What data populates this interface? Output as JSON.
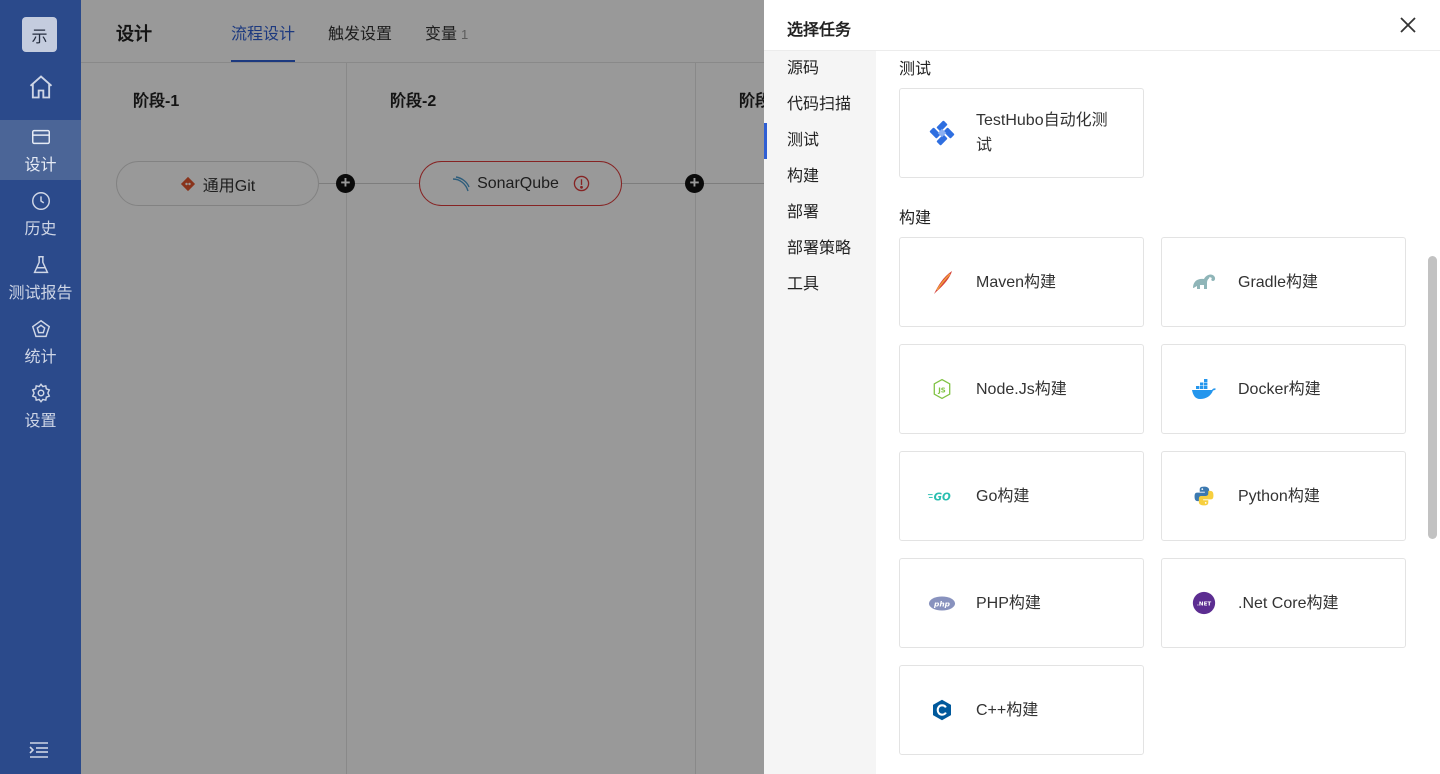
{
  "app": {
    "logo_text": "示"
  },
  "nav": {
    "items": [
      {
        "label": "设计",
        "icon": "card-icon",
        "active": true
      },
      {
        "label": "历史",
        "icon": "clock-icon"
      },
      {
        "label": "测试报告",
        "icon": "flask-icon"
      },
      {
        "label": "统计",
        "icon": "pentagon-icon"
      },
      {
        "label": "设置",
        "icon": "gear-icon"
      }
    ]
  },
  "header": {
    "title": "设计",
    "tabs": [
      {
        "label": "流程设计",
        "active": true
      },
      {
        "label": "触发设置"
      },
      {
        "label": "变量",
        "count": "1"
      }
    ]
  },
  "pipeline": {
    "stages": [
      {
        "title": "阶段-1",
        "task": "通用Git",
        "task_icon": "git-icon"
      },
      {
        "title": "阶段-2",
        "task": "SonarQube",
        "task_icon": "sonarqube-icon",
        "status": "error"
      },
      {
        "title": "阶段"
      }
    ]
  },
  "drawer": {
    "title": "选择任务",
    "categories": [
      "源码",
      "代码扫描",
      "测试",
      "构建",
      "部署",
      "部署策略",
      "工具"
    ],
    "active_category": "测试",
    "sections": [
      {
        "title": "测试",
        "tasks": [
          {
            "label": "TestHubo自动化测试",
            "icon": "testhubo-icon"
          }
        ]
      },
      {
        "title": "构建",
        "tasks": [
          {
            "label": "Maven构建",
            "icon": "maven-icon"
          },
          {
            "label": "Gradle构建",
            "icon": "gradle-icon"
          },
          {
            "label": "Node.Js构建",
            "icon": "nodejs-icon"
          },
          {
            "label": "Docker构建",
            "icon": "docker-icon"
          },
          {
            "label": "Go构建",
            "icon": "go-icon"
          },
          {
            "label": "Python构建",
            "icon": "python-icon"
          },
          {
            "label": "PHP构建",
            "icon": "php-icon"
          },
          {
            "label": ".Net Core构建",
            "icon": "dotnet-icon"
          },
          {
            "label": "C++构建",
            "icon": "cpp-icon"
          }
        ]
      }
    ]
  },
  "colors": {
    "rail": "#2b4a8b",
    "accent": "#2f5fd4",
    "error": "#e03b3b"
  }
}
